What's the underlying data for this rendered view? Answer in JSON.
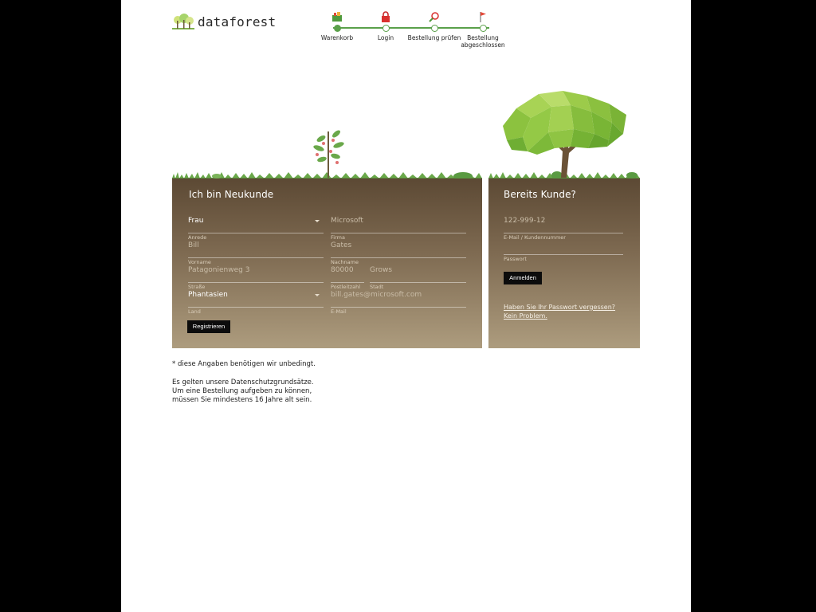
{
  "brand": {
    "name": "dataforest"
  },
  "steps": [
    {
      "icon": "shopping-basket-icon",
      "label": "Warenkorb",
      "done": true
    },
    {
      "icon": "lock-icon",
      "label": "Login",
      "done": false
    },
    {
      "icon": "magnifier-icon",
      "label": "Bestellung prüfen",
      "done": false
    },
    {
      "icon": "flag-icon",
      "label": "Bestellung abgeschlossen",
      "done": false
    }
  ],
  "new_customer": {
    "title": "Ich bin Neukunde",
    "salutation": {
      "value": "Frau",
      "caption": "Anrede"
    },
    "company": {
      "placeholder": "Microsoft",
      "caption": "Firma"
    },
    "first_name": {
      "placeholder": "Bill",
      "caption": "Vorname"
    },
    "last_name": {
      "placeholder": "Gates",
      "caption": "Nachname"
    },
    "street": {
      "placeholder": "Patagonienweg 3",
      "caption": "Straße"
    },
    "zip": {
      "placeholder": "80000",
      "caption": "Postleitzahl"
    },
    "city": {
      "placeholder": "Grows",
      "caption": "Stadt"
    },
    "country": {
      "value": "Phantasien",
      "caption": "Land"
    },
    "email": {
      "placeholder": "bill.gates@microsoft.com",
      "caption": "E-Mail"
    },
    "register_button": "Registrieren"
  },
  "existing_customer": {
    "title": "Bereits Kunde?",
    "login_id": {
      "placeholder": "122-999-12",
      "caption": "E-Mail / Kundennummer"
    },
    "password": {
      "placeholder": "",
      "caption": "Passwort"
    },
    "login_button": "Anmelden",
    "forgot_link": "Haben Sie Ihr Passwort vergessen? Kein Problem."
  },
  "notes": {
    "required": "* diese Angaben benötigen wir unbedingt.",
    "privacy": "Es gelten unsere Datenschutzgrundsätze. Um eine Bestellung aufgeben zu können, müssen Sie mindestens 16 Jahre alt sein."
  },
  "colors": {
    "accent": "#5aa04a",
    "panel_top": "#5c4934",
    "panel_bottom": "#ad9c7e",
    "button": "#0c0c0c"
  }
}
